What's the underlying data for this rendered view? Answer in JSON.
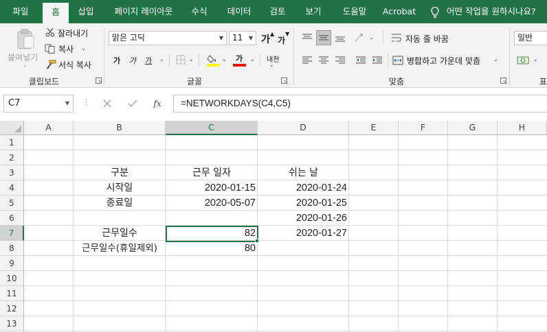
{
  "tabs": [
    {
      "label": "파일"
    },
    {
      "label": "홈",
      "active": true
    },
    {
      "label": "삽입"
    },
    {
      "label": "페이지 레이아웃"
    },
    {
      "label": "수식"
    },
    {
      "label": "데이터"
    },
    {
      "label": "검토"
    },
    {
      "label": "보기"
    },
    {
      "label": "도움말"
    },
    {
      "label": "Acrobat"
    }
  ],
  "tell_me": "어떤 작업을 원하시나요?",
  "ribbon": {
    "clipboard": {
      "paste_label": "붙여넣기",
      "cut_label": "잘라내기",
      "copy_label": "복사",
      "format_painter_label": "서식 복사",
      "group_label": "클립보드"
    },
    "font": {
      "font_name": "맑은 고딕",
      "font_size": "11",
      "grow_label": "가",
      "shrink_label": "가",
      "bold_label": "가",
      "italic_label": "가",
      "underline_label": "가",
      "font_color_label": "가",
      "phonetic_label": "내천",
      "group_label": "글꼴"
    },
    "alignment": {
      "wrap_text_label": "자동 줄 바꿈",
      "merge_center_label": "병합하고 가운데 맞춤",
      "group_label": "맞춤"
    },
    "number": {
      "format_value": "일반",
      "group_label": "표"
    }
  },
  "formula_bar": {
    "name_box": "C7",
    "formula": "=NETWORKDAYS(C4,C5)"
  },
  "columns": [
    "A",
    "B",
    "C",
    "D",
    "E",
    "F",
    "G",
    "H"
  ],
  "rows": [
    "1",
    "2",
    "3",
    "4",
    "5",
    "6",
    "7",
    "8",
    "9",
    "10",
    "11",
    "12",
    "13"
  ],
  "cells": {
    "B3": "구분",
    "C3": "근무 일자",
    "D3": "쉬는 날",
    "B4": "시작일",
    "C4": "2020-01-15",
    "D4": "2020-01-24",
    "B5": "종료일",
    "C5": "2020-05-07",
    "D5": "2020-01-25",
    "D6": "2020-01-26",
    "B7": "근무일수",
    "C7": "82",
    "D7": "2020-01-27",
    "B8": "근무일수(휴일제외)",
    "C8": "80"
  },
  "colors": {
    "accent": "#217346",
    "ribbon_bg": "#f3f3f3",
    "header_selected": "#d2d2d2",
    "highlight_yellow": "#ffff00",
    "font_red": "#ff0000"
  }
}
